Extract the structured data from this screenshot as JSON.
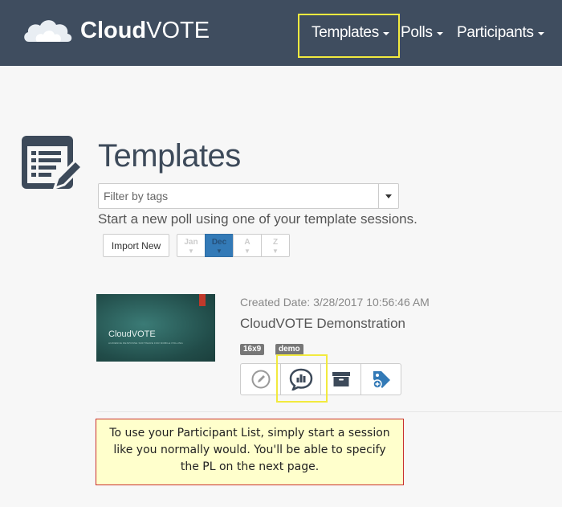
{
  "header": {
    "logo_bold": "Cloud",
    "logo_light": "VOTE",
    "nav": [
      {
        "label": "Templates",
        "icon": "caret-down-icon"
      },
      {
        "label": "Polls",
        "icon": "caret-down-icon"
      },
      {
        "label": "Participants",
        "icon": "caret-down-icon"
      }
    ]
  },
  "page": {
    "title": "Templates",
    "filter_placeholder": "Filter by tags",
    "subtitle": "Start a new poll using one of your template sessions.",
    "import_label": "Import New",
    "sort_buttons": [
      {
        "top": "Jan",
        "active": false
      },
      {
        "top": "Dec",
        "active": true
      },
      {
        "top": "A",
        "active": false
      },
      {
        "top": "Z",
        "active": false
      }
    ],
    "sort_arrow": "▼"
  },
  "session": {
    "thumbnail_title": "CloudVOTE",
    "thumbnail_subtitle": "AUDIENCE RESPONSE SOFTWARE FOR MOBILE POLLING",
    "created_label": "Created Date:",
    "created_value": "3/28/2017 10:56:46 AM",
    "name": "CloudVOTE Demonstration",
    "tags": [
      "16x9",
      "demo"
    ],
    "actions": [
      {
        "name": "edit-button",
        "icon": "pencil-icon"
      },
      {
        "name": "start-session-button",
        "icon": "chat-poll-icon"
      },
      {
        "name": "archive-button",
        "icon": "archive-icon"
      },
      {
        "name": "add-tag-button",
        "icon": "tag-plus-icon"
      }
    ]
  },
  "callout": {
    "text": "To use your Participant List, simply start a session like you normally would. You'll be able to specify the PL on the next page."
  },
  "colors": {
    "navbar": "#3f4d5f",
    "highlight": "#f2ea3f",
    "accent_blue": "#337ab7",
    "note_bg": "#ffffcc",
    "note_border": "#c9302c"
  }
}
